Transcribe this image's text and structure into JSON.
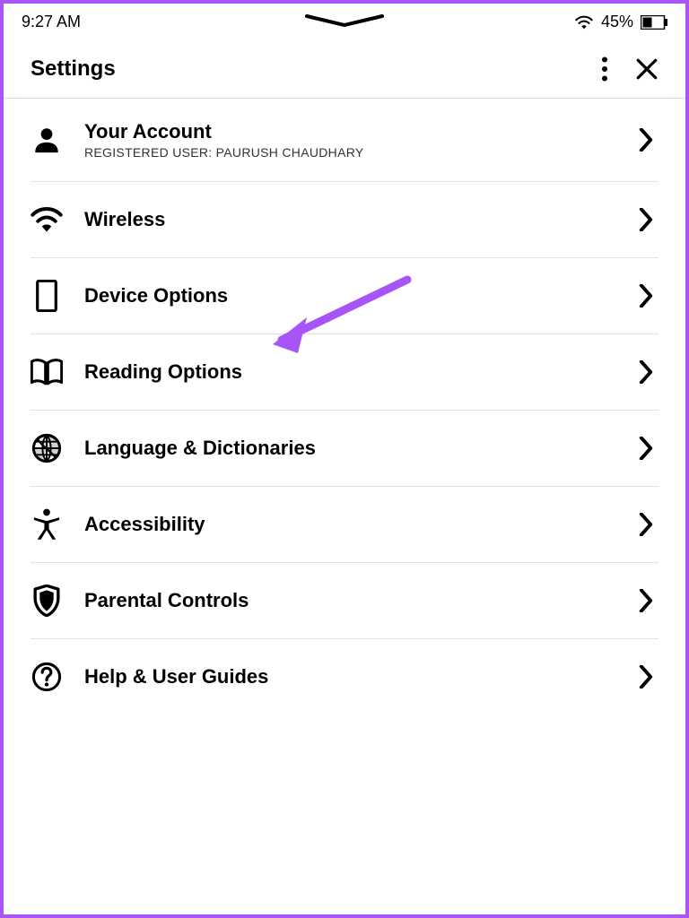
{
  "status": {
    "time": "9:27 AM",
    "battery_pct": "45%"
  },
  "header": {
    "title": "Settings"
  },
  "items": [
    {
      "title": "Your Account",
      "subtitle": "REGISTERED USER: PAURUSH CHAUDHARY"
    },
    {
      "title": "Wireless"
    },
    {
      "title": "Device Options"
    },
    {
      "title": "Reading Options"
    },
    {
      "title": "Language & Dictionaries"
    },
    {
      "title": "Accessibility"
    },
    {
      "title": "Parental Controls"
    },
    {
      "title": "Help & User Guides"
    }
  ]
}
